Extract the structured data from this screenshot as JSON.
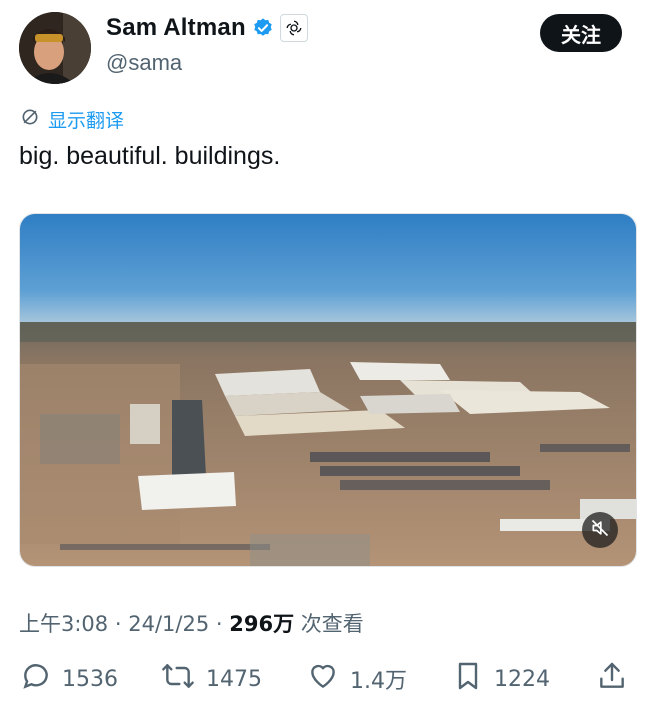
{
  "author": {
    "display_name": "Sam Altman",
    "handle": "@sama",
    "verified_icon": "verified-badge-icon",
    "affiliation_icon": "openai-logo-icon"
  },
  "follow_label": "关注",
  "translate_label": "显示翻译",
  "tweet": {
    "text": "big. beautiful. buildings."
  },
  "media": {
    "description_icon": "mute-icon"
  },
  "meta": {
    "time": "上午3:08",
    "separator": "·",
    "date": "24/1/25",
    "views_count": "296万",
    "views_label": " 次查看"
  },
  "actions": {
    "reply_count": "1536",
    "retweet_count": "1475",
    "like_count": "1.4万",
    "bookmark_count": "1224"
  },
  "colors": {
    "accent": "#1d9bf0",
    "text": "#0f1419",
    "muted": "#536471",
    "button_bg": "#0f1419"
  }
}
